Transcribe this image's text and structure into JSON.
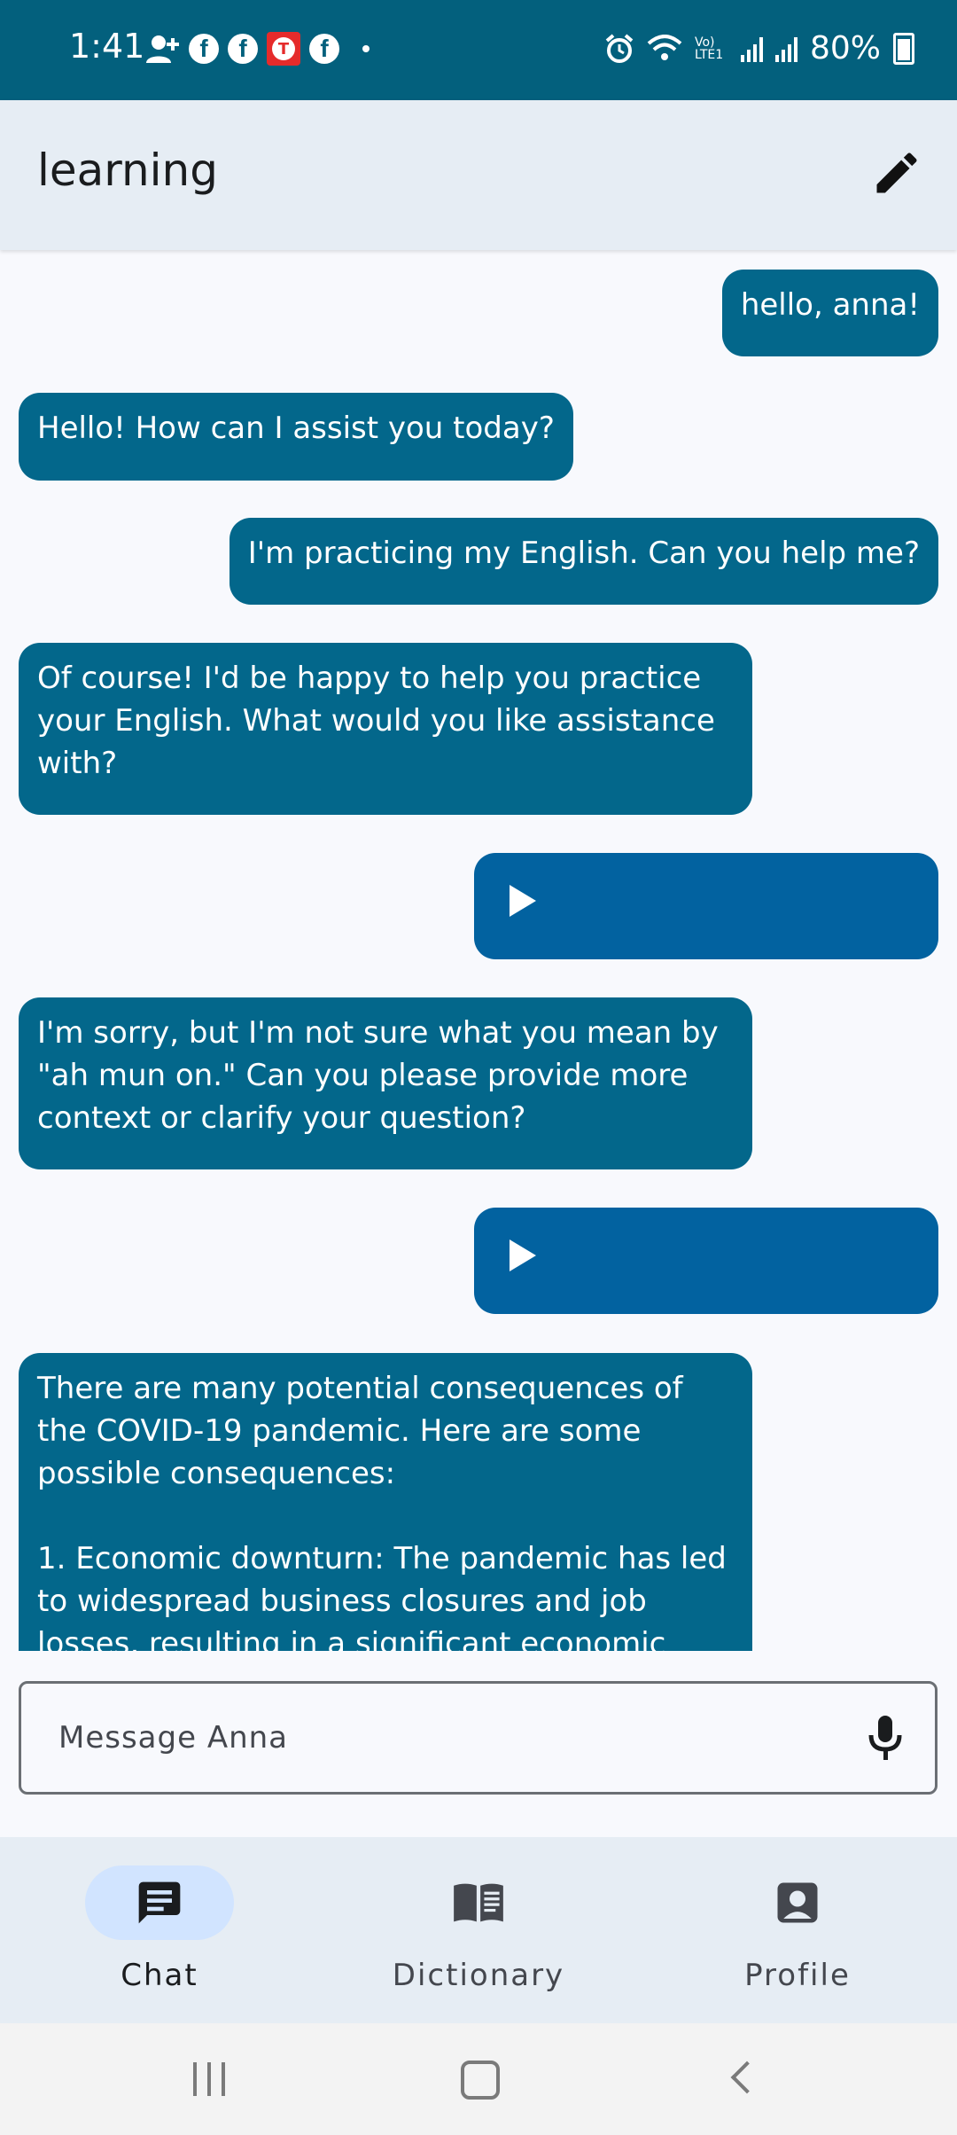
{
  "status_bar": {
    "time": "1:41",
    "battery": "80%",
    "network": "Vo) LTE1"
  },
  "app_bar": {
    "title": "learning"
  },
  "messages": [
    {
      "role": "user",
      "text": "hello, anna!"
    },
    {
      "role": "assistant",
      "text": "Hello! How can I assist you today?"
    },
    {
      "role": "user",
      "text": "I'm practicing my English. Can you help me?"
    },
    {
      "role": "assistant",
      "text": "Of course! I'd be happy to help you practice your English. What would you like assistance with?"
    },
    {
      "role": "user",
      "type": "audio"
    },
    {
      "role": "assistant",
      "text": "I'm sorry, but I'm not sure what you mean by \"ah mun on.\" Can you please provide more context or clarify your question?"
    },
    {
      "role": "user",
      "type": "audio"
    },
    {
      "role": "assistant",
      "text": "There are many potential consequences of the COVID-19 pandemic. Here are some possible consequences:\n\n1. Economic downturn: The pandemic has led to widespread business closures and job losses, resulting in a significant economic"
    }
  ],
  "input": {
    "placeholder": "Message Anna",
    "value": ""
  },
  "bottom_nav": {
    "items": [
      {
        "label": "Chat",
        "icon": "chat-icon",
        "active": true
      },
      {
        "label": "Dictionary",
        "icon": "book-icon",
        "active": false
      },
      {
        "label": "Profile",
        "icon": "profile-icon",
        "active": false
      }
    ]
  },
  "colors": {
    "status_bar": "#03607d",
    "bubble": "#03678b",
    "audio_bubble": "#0262a0",
    "nav_active": "#d1e4ff",
    "app_bar": "#e6edf4"
  }
}
